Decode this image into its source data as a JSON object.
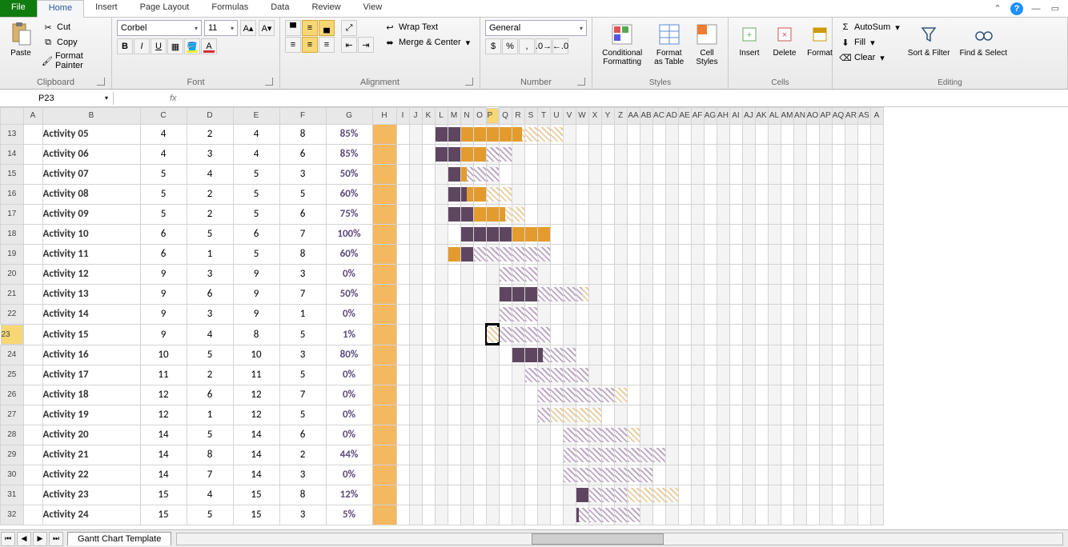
{
  "tabs": {
    "file": "File",
    "list": [
      "Home",
      "Insert",
      "Page Layout",
      "Formulas",
      "Data",
      "Review",
      "View"
    ],
    "active": 0
  },
  "ribbon": {
    "clipboard": {
      "paste": "Paste",
      "cut": "Cut",
      "copy": "Copy",
      "fp": "Format Painter",
      "label": "Clipboard"
    },
    "font": {
      "name": "Corbel",
      "size": "11",
      "label": "Font"
    },
    "alignment": {
      "wrap": "Wrap Text",
      "merge": "Merge & Center",
      "label": "Alignment"
    },
    "number": {
      "format": "General",
      "label": "Number"
    },
    "styles": {
      "cf": "Conditional Formatting",
      "fat": "Format as Table",
      "cs": "Cell Styles",
      "label": "Styles"
    },
    "cells": {
      "ins": "Insert",
      "del": "Delete",
      "fmt": "Format",
      "label": "Cells"
    },
    "editing": {
      "as": "AutoSum",
      "fill": "Fill",
      "clr": "Clear",
      "sf": "Sort & Filter",
      "fs": "Find & Select",
      "label": "Editing"
    }
  },
  "namebox": "P23",
  "sheetTab": "Gantt Chart Template",
  "cols": {
    "A": 24,
    "B": 122,
    "C": 58,
    "D": 58,
    "E": 58,
    "F": 58,
    "G": 58,
    "H": 30,
    "gstart": "I",
    "gwidth": 16,
    "glist": [
      "I",
      "J",
      "K",
      "L",
      "M",
      "N",
      "O",
      "P",
      "Q",
      "R",
      "S",
      "T",
      "U",
      "V",
      "W",
      "X",
      "Y",
      "Z",
      "AA",
      "AB",
      "AC",
      "AD",
      "AE",
      "AF",
      "AG",
      "AH",
      "AI",
      "AJ",
      "AK",
      "AL",
      "AM",
      "AN",
      "AO",
      "AP",
      "AQ",
      "AR",
      "AS",
      "A"
    ]
  },
  "selected": {
    "col": "P",
    "row": 23
  },
  "rows": [
    {
      "r": 13,
      "act": "Activity 05",
      "c": 4,
      "d": 2,
      "e": 4,
      "f": 8,
      "g": "85%",
      "bars": [
        {
          "t": "done1",
          "s": 4,
          "w": 2
        },
        {
          "t": "done2",
          "s": 6,
          "w": 4.8
        },
        {
          "t": "plan2",
          "s": 10.8,
          "w": 3.2
        }
      ]
    },
    {
      "r": 14,
      "act": "Activity 06",
      "c": 4,
      "d": 3,
      "e": 4,
      "f": 6,
      "g": "85%",
      "bars": [
        {
          "t": "done1",
          "s": 4,
          "w": 3
        },
        {
          "t": "plan",
          "s": 7,
          "w": 3
        },
        {
          "t": "done2",
          "s": 6,
          "w": 2
        }
      ]
    },
    {
      "r": 15,
      "act": "Activity 07",
      "c": 5,
      "d": 4,
      "e": 5,
      "f": 3,
      "g": "50%",
      "bars": [
        {
          "t": "done1",
          "s": 5,
          "w": 1.5
        },
        {
          "t": "plan",
          "s": 6.5,
          "w": 2.5
        },
        {
          "t": "done2",
          "s": 6,
          "w": 0.5
        }
      ]
    },
    {
      "r": 16,
      "act": "Activity 08",
      "c": 5,
      "d": 2,
      "e": 5,
      "f": 5,
      "g": "60%",
      "bars": [
        {
          "t": "done1",
          "s": 5,
          "w": 1.5
        },
        {
          "t": "done2",
          "s": 6.5,
          "w": 1.5
        },
        {
          "t": "plan2",
          "s": 8,
          "w": 2
        }
      ]
    },
    {
      "r": 17,
      "act": "Activity 09",
      "c": 5,
      "d": 2,
      "e": 5,
      "f": 6,
      "g": "75%",
      "bars": [
        {
          "t": "done1",
          "s": 5,
          "w": 2
        },
        {
          "t": "done2",
          "s": 7,
          "w": 2.5
        },
        {
          "t": "plan2",
          "s": 9.5,
          "w": 1.5
        }
      ]
    },
    {
      "r": 18,
      "act": "Activity 10",
      "c": 6,
      "d": 5,
      "e": 6,
      "f": 7,
      "g": "100%",
      "bars": [
        {
          "t": "done1",
          "s": 6,
          "w": 4
        },
        {
          "t": "done2",
          "s": 10,
          "w": 3
        }
      ]
    },
    {
      "r": 19,
      "act": "Activity 11",
      "c": 6,
      "d": 1,
      "e": 5,
      "f": 8,
      "g": "60%",
      "bars": [
        {
          "t": "done2",
          "s": 5,
          "w": 1
        },
        {
          "t": "done1",
          "s": 6,
          "w": 1
        },
        {
          "t": "plan",
          "s": 7,
          "w": 6
        }
      ]
    },
    {
      "r": 20,
      "act": "Activity 12",
      "c": 9,
      "d": 3,
      "e": 9,
      "f": 3,
      "g": "0%",
      "bars": [
        {
          "t": "plan",
          "s": 9,
          "w": 3
        }
      ]
    },
    {
      "r": 21,
      "act": "Activity 13",
      "c": 9,
      "d": 6,
      "e": 9,
      "f": 7,
      "g": "50%",
      "bars": [
        {
          "t": "done1",
          "s": 9,
          "w": 3
        },
        {
          "t": "plan",
          "s": 12,
          "w": 3.5
        },
        {
          "t": "plan2",
          "s": 15.5,
          "w": 0.5
        }
      ]
    },
    {
      "r": 22,
      "act": "Activity 14",
      "c": 9,
      "d": 3,
      "e": 9,
      "f": 1,
      "g": "0%",
      "bars": [
        {
          "t": "plan",
          "s": 9,
          "w": 3
        }
      ]
    },
    {
      "r": 23,
      "act": "Activity 15",
      "c": 9,
      "d": 4,
      "e": 8,
      "f": 5,
      "g": "1%",
      "bars": [
        {
          "t": "plan2",
          "s": 8,
          "w": 1
        },
        {
          "t": "plan",
          "s": 9,
          "w": 4
        }
      ]
    },
    {
      "r": 24,
      "act": "Activity 16",
      "c": 10,
      "d": 5,
      "e": 10,
      "f": 3,
      "g": "80%",
      "bars": [
        {
          "t": "done1",
          "s": 10,
          "w": 2.4
        },
        {
          "t": "plan",
          "s": 12.4,
          "w": 2.6
        }
      ]
    },
    {
      "r": 25,
      "act": "Activity 17",
      "c": 11,
      "d": 2,
      "e": 11,
      "f": 5,
      "g": "0%",
      "bars": [
        {
          "t": "plan",
          "s": 11,
          "w": 5
        }
      ]
    },
    {
      "r": 26,
      "act": "Activity 18",
      "c": 12,
      "d": 6,
      "e": 12,
      "f": 7,
      "g": "0%",
      "bars": [
        {
          "t": "plan",
          "s": 12,
          "w": 6
        },
        {
          "t": "plan2",
          "s": 18,
          "w": 1
        }
      ]
    },
    {
      "r": 27,
      "act": "Activity 19",
      "c": 12,
      "d": 1,
      "e": 12,
      "f": 5,
      "g": "0%",
      "bars": [
        {
          "t": "plan",
          "s": 12,
          "w": 1
        },
        {
          "t": "plan2",
          "s": 13,
          "w": 4
        }
      ]
    },
    {
      "r": 28,
      "act": "Activity 20",
      "c": 14,
      "d": 5,
      "e": 14,
      "f": 6,
      "g": "0%",
      "bars": [
        {
          "t": "plan",
          "s": 14,
          "w": 5
        },
        {
          "t": "plan2",
          "s": 19,
          "w": 1
        }
      ]
    },
    {
      "r": 29,
      "act": "Activity 21",
      "c": 14,
      "d": 8,
      "e": 14,
      "f": 2,
      "g": "44%",
      "bars": [
        {
          "t": "done1",
          "s": 14,
          "w": 1
        },
        {
          "t": "plan2",
          "s": 15,
          "w": 1
        },
        {
          "t": "plan",
          "s": 14,
          "w": 8
        }
      ]
    },
    {
      "r": 30,
      "act": "Activity 22",
      "c": 14,
      "d": 7,
      "e": 14,
      "f": 3,
      "g": "0%",
      "bars": [
        {
          "t": "plan",
          "s": 14,
          "w": 7
        }
      ]
    },
    {
      "r": 31,
      "act": "Activity 23",
      "c": 15,
      "d": 4,
      "e": 15,
      "f": 8,
      "g": "12%",
      "bars": [
        {
          "t": "done1",
          "s": 15,
          "w": 1
        },
        {
          "t": "plan",
          "s": 16,
          "w": 3
        },
        {
          "t": "plan2",
          "s": 19,
          "w": 4
        }
      ]
    },
    {
      "r": 32,
      "act": "Activity 24",
      "c": 15,
      "d": 5,
      "e": 15,
      "f": 3,
      "g": "5%",
      "bars": [
        {
          "t": "done1",
          "s": 15,
          "w": 0.2
        },
        {
          "t": "plan",
          "s": 15.2,
          "w": 4.8
        }
      ]
    }
  ],
  "chart_data": {
    "type": "gantt",
    "title": "Gantt Chart Template",
    "x_unit": "period",
    "series": [
      {
        "name": "Activity 05",
        "plan_start": 4,
        "plan_dur": 2,
        "act_start": 4,
        "act_dur": 8,
        "pct": 85
      },
      {
        "name": "Activity 06",
        "plan_start": 4,
        "plan_dur": 3,
        "act_start": 4,
        "act_dur": 6,
        "pct": 85
      },
      {
        "name": "Activity 07",
        "plan_start": 5,
        "plan_dur": 4,
        "act_start": 5,
        "act_dur": 3,
        "pct": 50
      },
      {
        "name": "Activity 08",
        "plan_start": 5,
        "plan_dur": 2,
        "act_start": 5,
        "act_dur": 5,
        "pct": 60
      },
      {
        "name": "Activity 09",
        "plan_start": 5,
        "plan_dur": 2,
        "act_start": 5,
        "act_dur": 6,
        "pct": 75
      },
      {
        "name": "Activity 10",
        "plan_start": 6,
        "plan_dur": 5,
        "act_start": 6,
        "act_dur": 7,
        "pct": 100
      },
      {
        "name": "Activity 11",
        "plan_start": 6,
        "plan_dur": 1,
        "act_start": 5,
        "act_dur": 8,
        "pct": 60
      },
      {
        "name": "Activity 12",
        "plan_start": 9,
        "plan_dur": 3,
        "act_start": 9,
        "act_dur": 3,
        "pct": 0
      },
      {
        "name": "Activity 13",
        "plan_start": 9,
        "plan_dur": 6,
        "act_start": 9,
        "act_dur": 7,
        "pct": 50
      },
      {
        "name": "Activity 14",
        "plan_start": 9,
        "plan_dur": 3,
        "act_start": 9,
        "act_dur": 1,
        "pct": 0
      },
      {
        "name": "Activity 15",
        "plan_start": 9,
        "plan_dur": 4,
        "act_start": 8,
        "act_dur": 5,
        "pct": 1
      },
      {
        "name": "Activity 16",
        "plan_start": 10,
        "plan_dur": 5,
        "act_start": 10,
        "act_dur": 3,
        "pct": 80
      },
      {
        "name": "Activity 17",
        "plan_start": 11,
        "plan_dur": 2,
        "act_start": 11,
        "act_dur": 5,
        "pct": 0
      },
      {
        "name": "Activity 18",
        "plan_start": 12,
        "plan_dur": 6,
        "act_start": 12,
        "act_dur": 7,
        "pct": 0
      },
      {
        "name": "Activity 19",
        "plan_start": 12,
        "plan_dur": 1,
        "act_start": 12,
        "act_dur": 5,
        "pct": 0
      },
      {
        "name": "Activity 20",
        "plan_start": 14,
        "plan_dur": 5,
        "act_start": 14,
        "act_dur": 6,
        "pct": 0
      },
      {
        "name": "Activity 21",
        "plan_start": 14,
        "plan_dur": 8,
        "act_start": 14,
        "act_dur": 2,
        "pct": 44
      },
      {
        "name": "Activity 22",
        "plan_start": 14,
        "plan_dur": 7,
        "act_start": 14,
        "act_dur": 3,
        "pct": 0
      },
      {
        "name": "Activity 23",
        "plan_start": 15,
        "plan_dur": 4,
        "act_start": 15,
        "act_dur": 8,
        "pct": 12
      },
      {
        "name": "Activity 24",
        "plan_start": 15,
        "plan_dur": 5,
        "act_start": 15,
        "act_dur": 3,
        "pct": 5
      }
    ]
  }
}
